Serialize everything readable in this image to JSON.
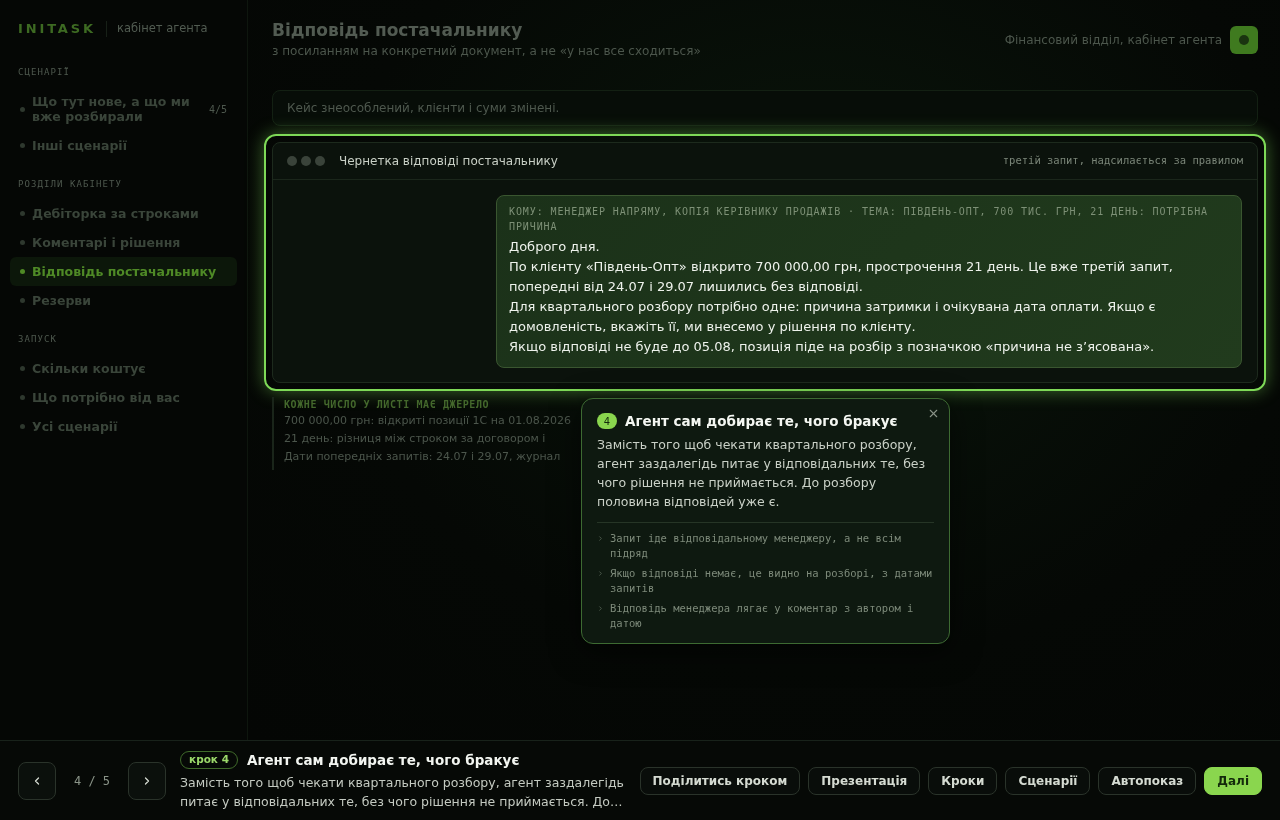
{
  "sidebar": {
    "brand": "INITASK",
    "subtitle": "кабінет агента",
    "sections": [
      {
        "label": "СЦЕНАРІЇ",
        "items": [
          {
            "label": "Що тут нове, а що ми вже розбирали",
            "count": "4/5",
            "selected": false
          },
          {
            "label": "Інші сценарії",
            "selected": false
          }
        ]
      },
      {
        "label": "РОЗДІЛИ КАБІНЕТУ",
        "items": [
          {
            "label": "Дебіторка за строками",
            "selected": false
          },
          {
            "label": "Коментарі і рішення",
            "selected": false
          },
          {
            "label": "Відповідь постачальнику",
            "selected": true
          },
          {
            "label": "Резерви",
            "selected": false
          }
        ]
      },
      {
        "label": "ЗАПУСК",
        "items": [
          {
            "label": "Скільки коштує",
            "selected": false
          },
          {
            "label": "Що потрібно від вас",
            "selected": false
          },
          {
            "label": "Усі сценарії",
            "selected": false
          }
        ]
      }
    ]
  },
  "header": {
    "title": "Відповідь постачальнику",
    "subtitle": "з посиланням на конкретний документ, а не «у нас все сходиться»",
    "account": "Фінансовий відділ, кабінет агента"
  },
  "notice": "Кейс знеособлений, клієнти і суми змінені.",
  "draft": {
    "title": "Чернетка відповіді постачальнику",
    "note": "третій запит, надсилається за правилом",
    "message": {
      "meta": "КОМУ: МЕНЕДЖЕР НАПРЯМУ, КОПІЯ КЕРІВНИКУ ПРОДАЖІВ · ТЕМА: ПІВДЕНЬ-ОПТ, 700 ТИС. ГРН, 21 ДЕНЬ: ПОТРІБНА ПРИЧИНА",
      "paragraphs": [
        "Доброго дня.",
        "По клієнту «Південь-Опт» відкрито 700 000,00 грн, прострочення 21 день. Це вже третій запит, попередні від 24.07 і 29.07 лишились без відповіді.",
        "Для квартального розбору потрібно одне: причина затримки і очікувана дата оплати. Якщо є домовленість, вкажіть її, ми внесемо у рішення по клієнту.",
        "Якщо відповіді не буде до 05.08, позиція піде на розбір з позначкою «причина не з’ясована»."
      ]
    }
  },
  "sources": {
    "heading": "КОЖНЕ ЧИСЛО У ЛИСТІ МАЄ ДЖЕРЕЛО",
    "lines": [
      "700 000,00 грн: відкриті позиції 1С на 01.08.2026",
      "21 день: різниця між строком за договором і",
      "Дати попередніх запитів: 24.07 і 29.07, журнал"
    ]
  },
  "popover": {
    "step": "4",
    "title": "Агент сам добирає те, чого бракує",
    "body": "Замість того щоб чекати квартального розбору, агент заздалегідь питає у відповідальних те, без чого рішення не приймається. До розбору половина відповідей уже є.",
    "points": [
      "Запит іде відповідальному менеджеру, а не всім підряд",
      "Якщо відповіді немає, це видно на розборі, з датами запитів",
      "Відповідь менеджера лягає у коментар з автором і датою"
    ]
  },
  "footer": {
    "counter": "4 / 5",
    "step_badge": "крок 4",
    "title": "Агент сам добирає те, чого бракує",
    "description": "Замість того щоб чекати квартального розбору, агент заздалегідь питає у відповідальних те, без чого рішення не приймається. До…",
    "buttons": [
      {
        "label": "Поділитись кроком",
        "kind": "outline"
      },
      {
        "label": "Презентація",
        "kind": "outline"
      },
      {
        "label": "Кроки",
        "kind": "outline"
      },
      {
        "label": "Сценарії",
        "kind": "outline"
      },
      {
        "label": "Автопоказ",
        "kind": "outline"
      },
      {
        "label": "Далі",
        "kind": "primary"
      }
    ]
  }
}
